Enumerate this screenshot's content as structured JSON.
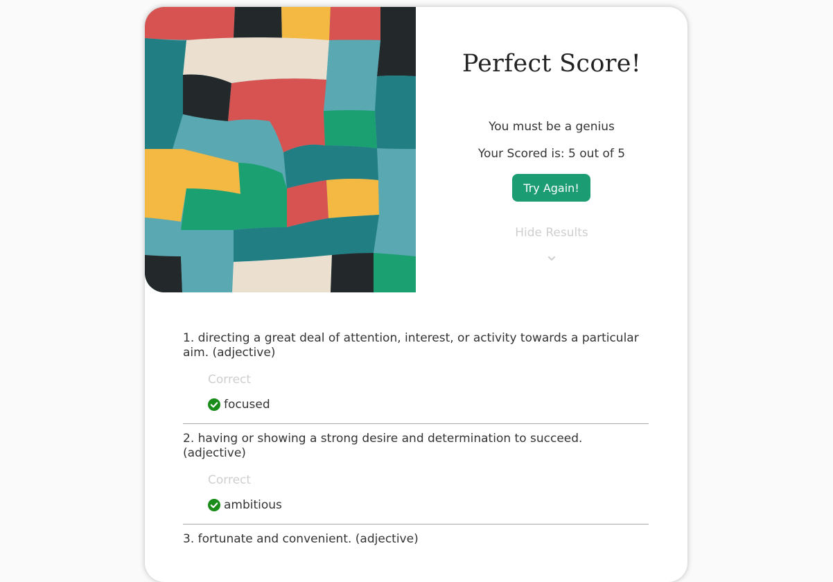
{
  "result": {
    "title": "Perfect Score!",
    "message": "You must be a genius",
    "score_text": "Your Scored is: 5 out of 5",
    "try_again_label": "Try Again!",
    "hide_results_label": "Hide Results"
  },
  "questions": [
    {
      "text": "1. directing a great deal of attention, interest, or activity towards a particular aim. (adjective)",
      "status": "Correct",
      "answer": "focused"
    },
    {
      "text": "2. having or showing a strong desire and determination to succeed. (adjective)",
      "status": "Correct",
      "answer": "ambitious"
    },
    {
      "text": "3. fortunate and convenient. (adjective)"
    }
  ],
  "colors": {
    "accent_green": "#1c9c73",
    "check_green": "#1a8c1a",
    "muted_text": "#cfcfcf",
    "art_red": "#d75352",
    "art_dark": "#23292b",
    "art_yellow": "#f3b943",
    "art_teal": "#217f84",
    "art_light_teal": "#5aa8b2",
    "art_cream": "#ebdfd0",
    "art_green": "#1ba072"
  }
}
